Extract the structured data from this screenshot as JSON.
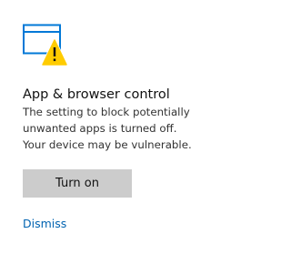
{
  "card": {
    "icon": "browser-window-warning-icon",
    "title": "App & browser control",
    "description_lines": [
      "The setting to block potentially",
      "unwanted apps is turned off.",
      "Your device may be vulnerable."
    ],
    "primary_button_label": "Turn on",
    "dismiss_label": "Dismiss"
  },
  "colors": {
    "accent": "#0078d7",
    "link": "#0063b1",
    "warning": "#ffcc00",
    "button_bg": "#cccccc",
    "text": "#111111"
  }
}
